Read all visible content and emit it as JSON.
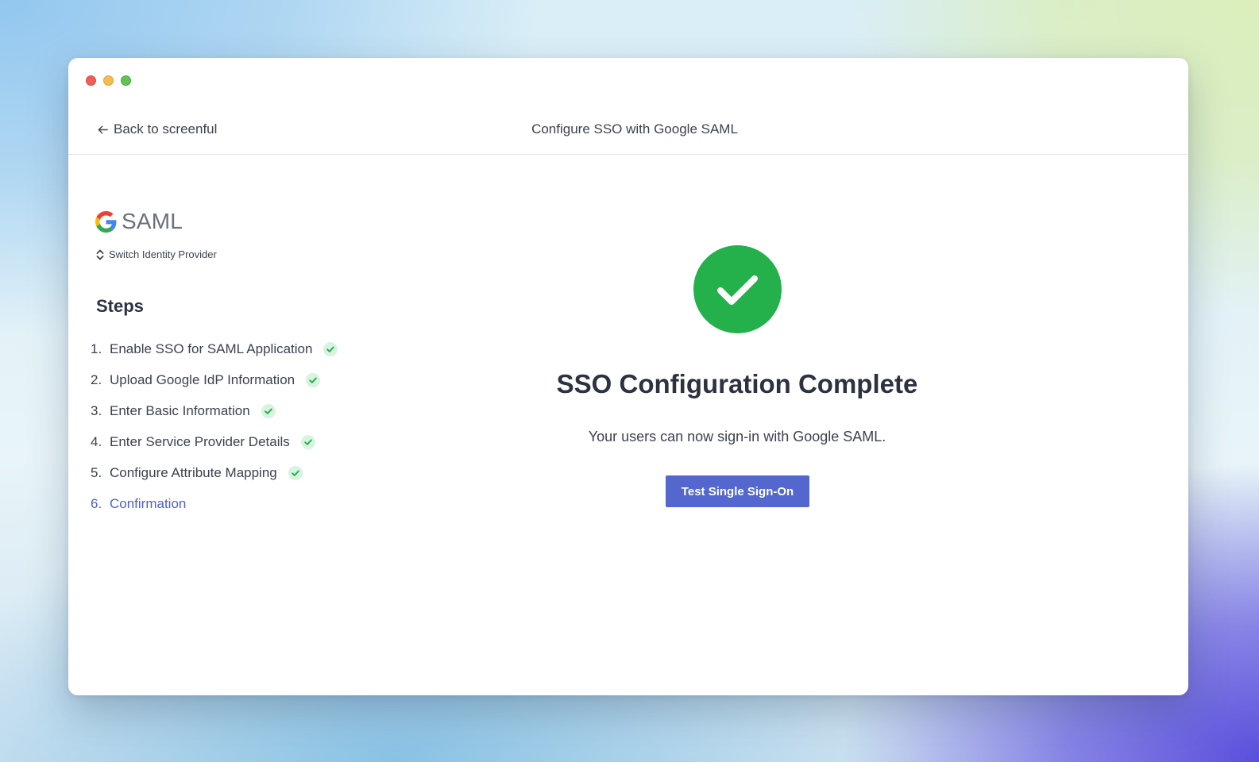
{
  "window": {
    "traffic_lights": [
      "close",
      "minimize",
      "zoom"
    ]
  },
  "header": {
    "back_label": "Back to screenful",
    "title": "Configure SSO with Google SAML"
  },
  "sidebar": {
    "provider_icon": "google-g-icon",
    "provider_name": "SAML",
    "switch_label": "Switch Identity Provider",
    "steps_heading": "Steps",
    "steps": [
      {
        "num": "1.",
        "label": "Enable SSO for SAML Application",
        "completed": true
      },
      {
        "num": "2.",
        "label": "Upload Google IdP Information",
        "completed": true
      },
      {
        "num": "3.",
        "label": "Enter Basic Information",
        "completed": true
      },
      {
        "num": "4.",
        "label": "Enter Service Provider Details",
        "completed": true
      },
      {
        "num": "5.",
        "label": "Configure Attribute Mapping",
        "completed": true
      },
      {
        "num": "6.",
        "label": "Confirmation",
        "completed": false,
        "active": true
      }
    ]
  },
  "main": {
    "headline": "SSO Configuration Complete",
    "message": "Your users can now sign-in with Google SAML.",
    "button_label": "Test Single Sign-On"
  },
  "colors": {
    "success": "#24b04a",
    "accent": "#5367cf",
    "active_step": "#4e63c9",
    "check_bg": "#d8f3df",
    "check_mark": "#24b04a"
  }
}
